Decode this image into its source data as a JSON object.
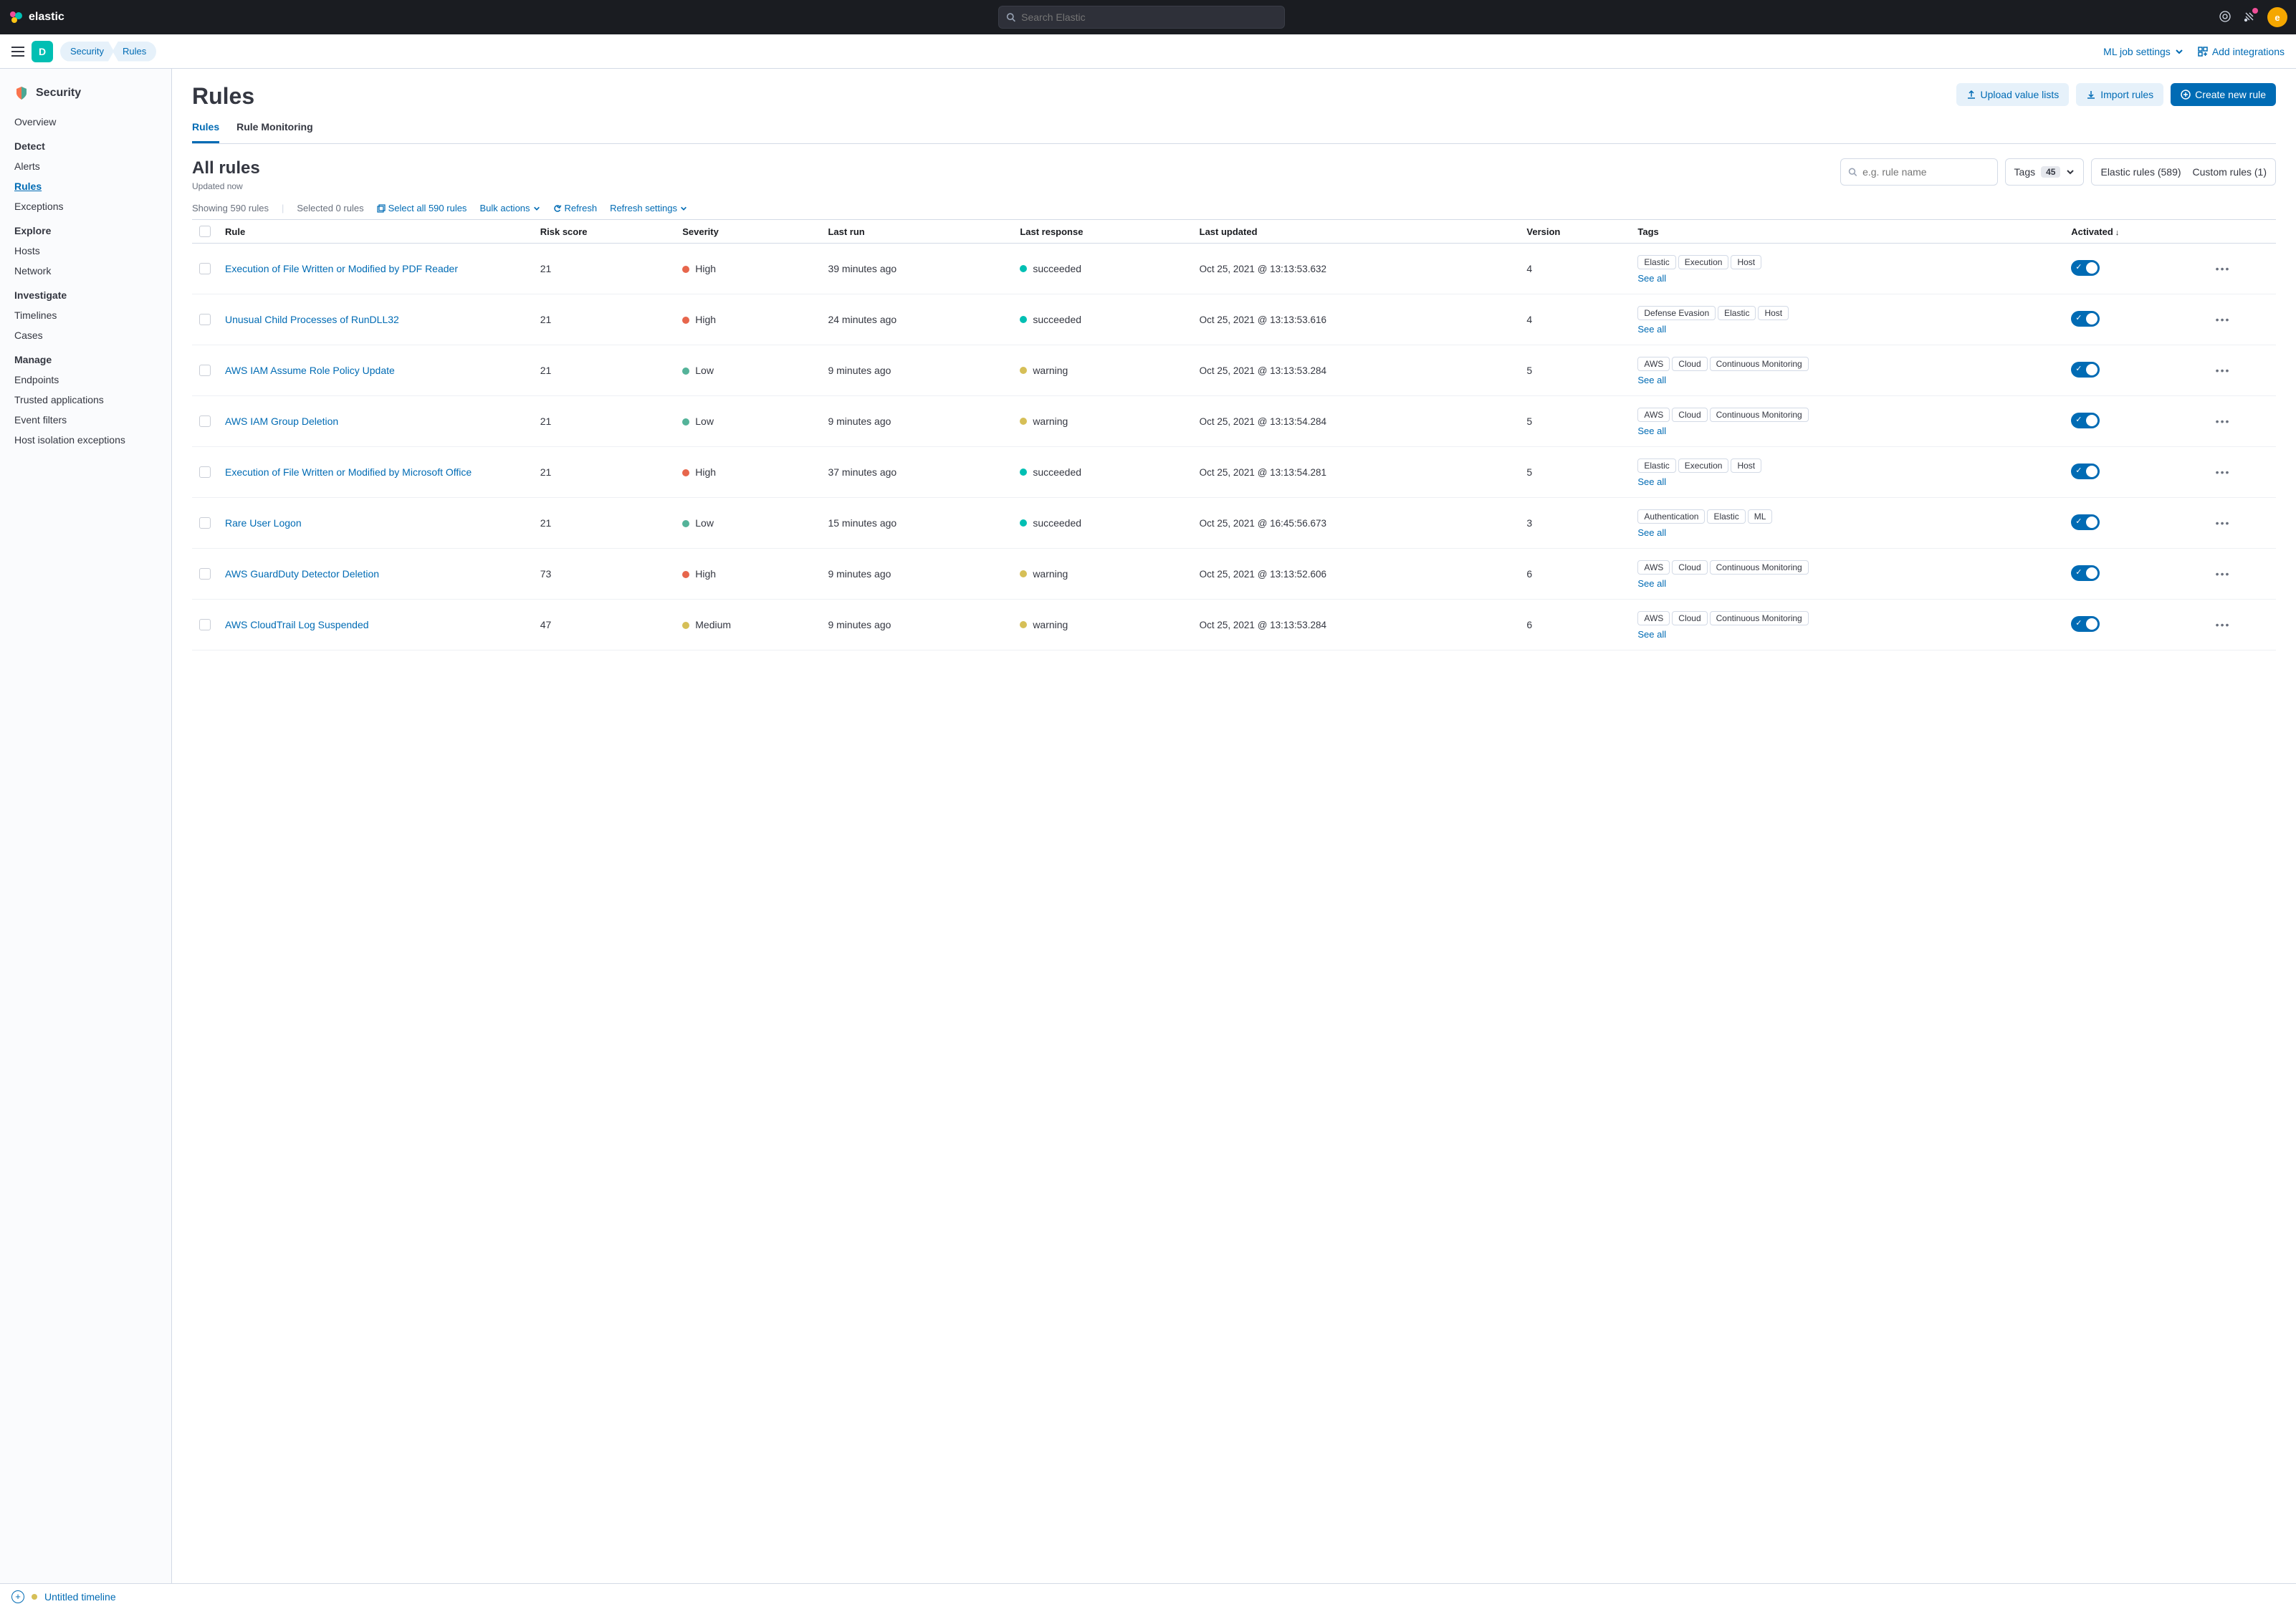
{
  "header": {
    "brand": "elastic",
    "search_placeholder": "Search Elastic",
    "avatar_initial": "e"
  },
  "subheader": {
    "space_initial": "D",
    "crumbs": [
      "Security",
      "Rules"
    ],
    "ml_settings": "ML job settings",
    "add_integrations": "Add integrations"
  },
  "sidebar": {
    "title": "Security",
    "groups": [
      {
        "label": "",
        "items": [
          {
            "label": "Overview",
            "active": false
          }
        ]
      },
      {
        "label": "Detect",
        "items": [
          {
            "label": "Alerts",
            "active": false
          },
          {
            "label": "Rules",
            "active": true
          },
          {
            "label": "Exceptions",
            "active": false
          }
        ]
      },
      {
        "label": "Explore",
        "items": [
          {
            "label": "Hosts",
            "active": false
          },
          {
            "label": "Network",
            "active": false
          }
        ]
      },
      {
        "label": "Investigate",
        "items": [
          {
            "label": "Timelines",
            "active": false
          },
          {
            "label": "Cases",
            "active": false
          }
        ]
      },
      {
        "label": "Manage",
        "items": [
          {
            "label": "Endpoints",
            "active": false
          },
          {
            "label": "Trusted applications",
            "active": false
          },
          {
            "label": "Event filters",
            "active": false
          },
          {
            "label": "Host isolation exceptions",
            "active": false
          }
        ]
      }
    ]
  },
  "page": {
    "title": "Rules",
    "actions": {
      "upload": "Upload value lists",
      "import": "Import rules",
      "create": "Create new rule"
    },
    "tabs": [
      {
        "label": "Rules",
        "active": true
      },
      {
        "label": "Rule Monitoring",
        "active": false
      }
    ],
    "all_rules_title": "All rules",
    "updated_text": "Updated now",
    "search_placeholder": "e.g. rule name",
    "tags_label": "Tags",
    "tags_count": "45",
    "elastic_rules": "Elastic rules (589)",
    "custom_rules": "Custom rules (1)",
    "showing": "Showing 590 rules",
    "selected": "Selected 0 rules",
    "select_all": "Select all 590 rules",
    "bulk": "Bulk actions",
    "refresh": "Refresh",
    "refresh_settings": "Refresh settings",
    "columns": {
      "rule": "Rule",
      "risk": "Risk score",
      "severity": "Severity",
      "lastrun": "Last run",
      "lastresp": "Last response",
      "updated": "Last updated",
      "version": "Version",
      "tags": "Tags",
      "activated": "Activated"
    },
    "see_all": "See all",
    "rows": [
      {
        "name": "Execution of File Written or Modified by PDF Reader",
        "risk": "21",
        "severity": "High",
        "sev_class": "sev-high",
        "lastrun": "39 minutes ago",
        "resp": "succeeded",
        "resp_class": "resp-succeeded",
        "updated": "Oct 25, 2021 @ 13:13:53.632",
        "version": "4",
        "tags": [
          "Elastic",
          "Execution",
          "Host"
        ],
        "more": true
      },
      {
        "name": "Unusual Child Processes of RunDLL32",
        "risk": "21",
        "severity": "High",
        "sev_class": "sev-high",
        "lastrun": "24 minutes ago",
        "resp": "succeeded",
        "resp_class": "resp-succeeded",
        "updated": "Oct 25, 2021 @ 13:13:53.616",
        "version": "4",
        "tags": [
          "Defense Evasion",
          "Elastic",
          "Host"
        ],
        "more": true
      },
      {
        "name": "AWS IAM Assume Role Policy Update",
        "risk": "21",
        "severity": "Low",
        "sev_class": "sev-low",
        "lastrun": "9 minutes ago",
        "resp": "warning",
        "resp_class": "resp-warning",
        "updated": "Oct 25, 2021 @ 13:13:53.284",
        "version": "5",
        "tags": [
          "AWS",
          "Cloud",
          "Continuous Monitoring"
        ],
        "more": true
      },
      {
        "name": "AWS IAM Group Deletion",
        "risk": "21",
        "severity": "Low",
        "sev_class": "sev-low",
        "lastrun": "9 minutes ago",
        "resp": "warning",
        "resp_class": "resp-warning",
        "updated": "Oct 25, 2021 @ 13:13:54.284",
        "version": "5",
        "tags": [
          "AWS",
          "Cloud",
          "Continuous Monitoring"
        ],
        "more": true
      },
      {
        "name": "Execution of File Written or Modified by Microsoft Office",
        "risk": "21",
        "severity": "High",
        "sev_class": "sev-high",
        "lastrun": "37 minutes ago",
        "resp": "succeeded",
        "resp_class": "resp-succeeded",
        "updated": "Oct 25, 2021 @ 13:13:54.281",
        "version": "5",
        "tags": [
          "Elastic",
          "Execution",
          "Host"
        ],
        "more": true
      },
      {
        "name": "Rare User Logon",
        "risk": "21",
        "severity": "Low",
        "sev_class": "sev-low",
        "lastrun": "15 minutes ago",
        "resp": "succeeded",
        "resp_class": "resp-succeeded",
        "updated": "Oct 25, 2021 @ 16:45:56.673",
        "version": "3",
        "tags": [
          "Authentication",
          "Elastic",
          "ML"
        ],
        "more": true
      },
      {
        "name": "AWS GuardDuty Detector Deletion",
        "risk": "73",
        "severity": "High",
        "sev_class": "sev-high",
        "lastrun": "9 minutes ago",
        "resp": "warning",
        "resp_class": "resp-warning",
        "updated": "Oct 25, 2021 @ 13:13:52.606",
        "version": "6",
        "tags": [
          "AWS",
          "Cloud",
          "Continuous Monitoring"
        ],
        "more": true
      },
      {
        "name": "AWS CloudTrail Log Suspended",
        "risk": "47",
        "severity": "Medium",
        "sev_class": "sev-medium",
        "lastrun": "9 minutes ago",
        "resp": "warning",
        "resp_class": "resp-warning",
        "updated": "Oct 25, 2021 @ 13:13:53.284",
        "version": "6",
        "tags": [
          "AWS",
          "Cloud",
          "Continuous Monitoring"
        ],
        "more": true
      }
    ]
  },
  "bottom": {
    "timeline": "Untitled timeline"
  }
}
